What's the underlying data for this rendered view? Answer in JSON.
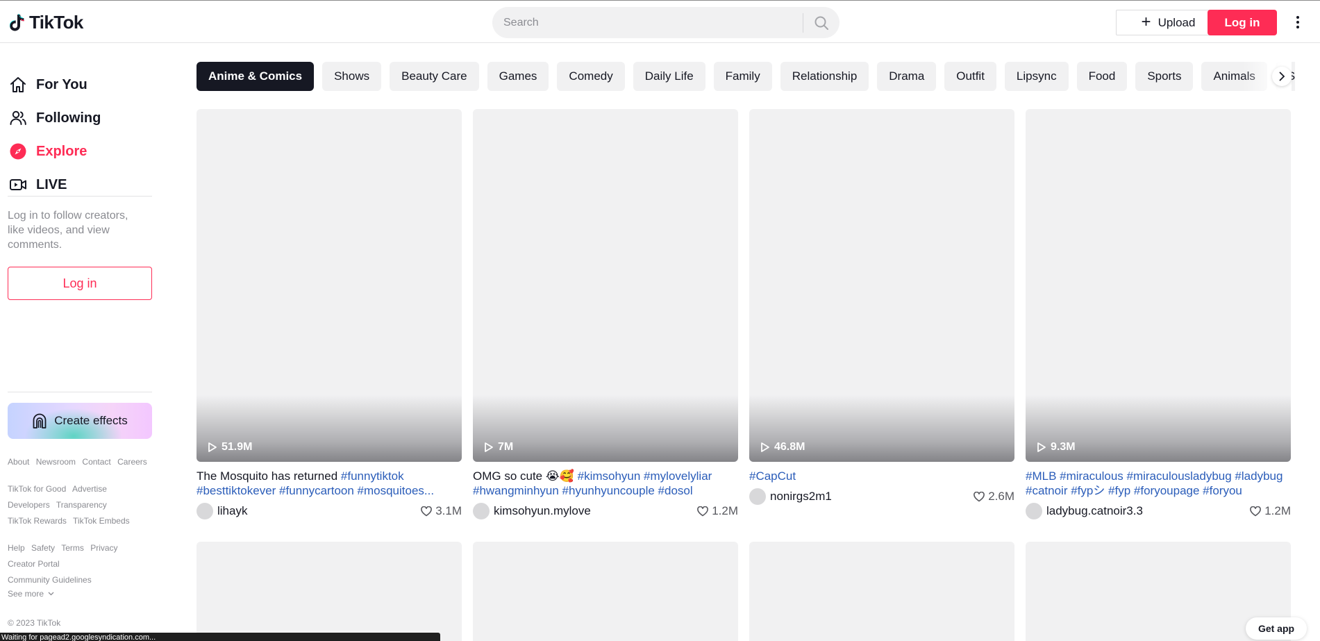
{
  "header": {
    "logo_text": "TikTok",
    "search_placeholder": "Search",
    "upload_label": "Upload",
    "login_label": "Log in"
  },
  "sidebar": {
    "nav": [
      {
        "label": "For You",
        "icon": "home-icon",
        "active": false
      },
      {
        "label": "Following",
        "icon": "users-icon",
        "active": false
      },
      {
        "label": "Explore",
        "icon": "compass-icon",
        "active": true
      },
      {
        "label": "LIVE",
        "icon": "live-camera-icon",
        "active": false
      }
    ],
    "login_prompt": "Log in to follow creators, like videos, and view comments.",
    "login_label": "Log in",
    "effects_label": "Create effects",
    "footer_groups": [
      [
        "About",
        "Newsroom",
        "Contact",
        "Careers"
      ],
      [
        "TikTok for Good",
        "Advertise",
        "Developers",
        "Transparency",
        "TikTok Rewards",
        "TikTok Embeds"
      ],
      [
        "Help",
        "Safety",
        "Terms",
        "Privacy",
        "Creator Portal",
        "Community Guidelines"
      ]
    ],
    "see_more": "See more",
    "copyright": "© 2023 TikTok"
  },
  "categories": {
    "items": [
      "Anime & Comics",
      "Shows",
      "Beauty Care",
      "Games",
      "Comedy",
      "Daily Life",
      "Family",
      "Relationship",
      "Drama",
      "Outfit",
      "Lipsync",
      "Food",
      "Sports",
      "Animals",
      "Society"
    ],
    "active_index": 0
  },
  "videos": [
    {
      "views": "51.9M",
      "caption_text": "The Mosquito has returned ",
      "tags": "#funnytiktok #besttiktokever #funnycartoon #mosquitoes...",
      "author": "lihayk",
      "likes": "3.1M"
    },
    {
      "views": "7M",
      "caption_text": "OMG so cute 😭🥰 ",
      "tags": "#kimsohyun #mylovelyliar #hwangminhyun #hyunhyuncouple #dosol",
      "author": "kimsohyun.mylove",
      "likes": "1.2M"
    },
    {
      "views": "46.8M",
      "caption_text": "",
      "tags": "#CapCut",
      "author": "nonirgs2m1",
      "likes": "2.6M"
    },
    {
      "views": "9.3M",
      "caption_text": "",
      "tags": "#MLB #miraculous #miraculousladybug #ladybug #catnoir #fypシ #fyp #foryoupage #foryou",
      "author": "ladybug.catnoir3.3",
      "likes": "1.2M"
    }
  ],
  "get_app": "Get app",
  "status_bar": "Waiting for pagead2.googlesyndication.com...",
  "colors": {
    "brand": "#fe2c55",
    "tag": "#2b5db9",
    "text": "#161823",
    "muted": "#8a8b91"
  }
}
